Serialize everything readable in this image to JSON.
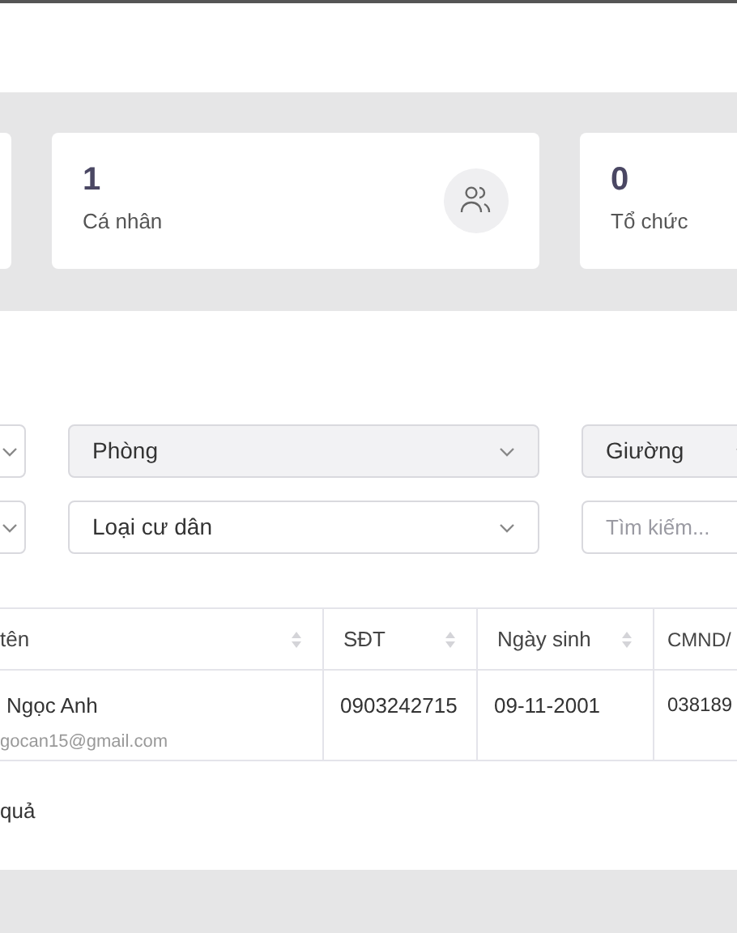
{
  "stats": [
    {
      "value": "1",
      "label": "Cá nhân",
      "kind": "people"
    },
    {
      "value": "0",
      "label": "Tổ chức",
      "kind": "none"
    }
  ],
  "filters": [
    {
      "placeholder": "Phòng",
      "kind": "select",
      "disabled": true
    },
    {
      "placeholder": "Giường",
      "kind": "select",
      "disabled": true
    },
    {
      "placeholder": "Loại cư dân",
      "kind": "select",
      "disabled": false
    },
    {
      "placeholder": "Tìm kiếm...",
      "kind": "search",
      "disabled": false
    }
  ],
  "table": {
    "columns": [
      {
        "label": "tên",
        "kind": "sortable"
      },
      {
        "label": "SĐT",
        "kind": "sortable"
      },
      {
        "label": "Ngày sinh",
        "kind": "sortable"
      },
      {
        "label": "CMND/",
        "kind": "plain"
      }
    ],
    "rows": [
      {
        "name": "Ngọc Anh",
        "email": "gocan15@gmail.com",
        "phone": "0903242715",
        "birth": "09-11-2001",
        "id": "038189"
      }
    ]
  },
  "footer": "quả"
}
